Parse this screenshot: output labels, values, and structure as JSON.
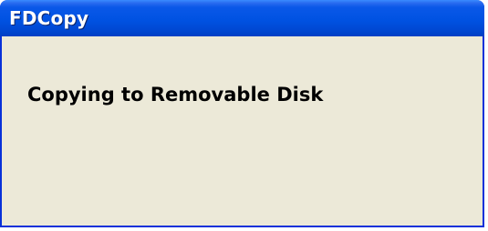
{
  "window": {
    "title": "FDCopy",
    "message": "Copying to Removable Disk"
  },
  "colors": {
    "titlebar": "#0052e2",
    "border": "#0831d9",
    "client_background": "#ece9d8",
    "title_text": "#ffffff",
    "message_text": "#000000"
  }
}
